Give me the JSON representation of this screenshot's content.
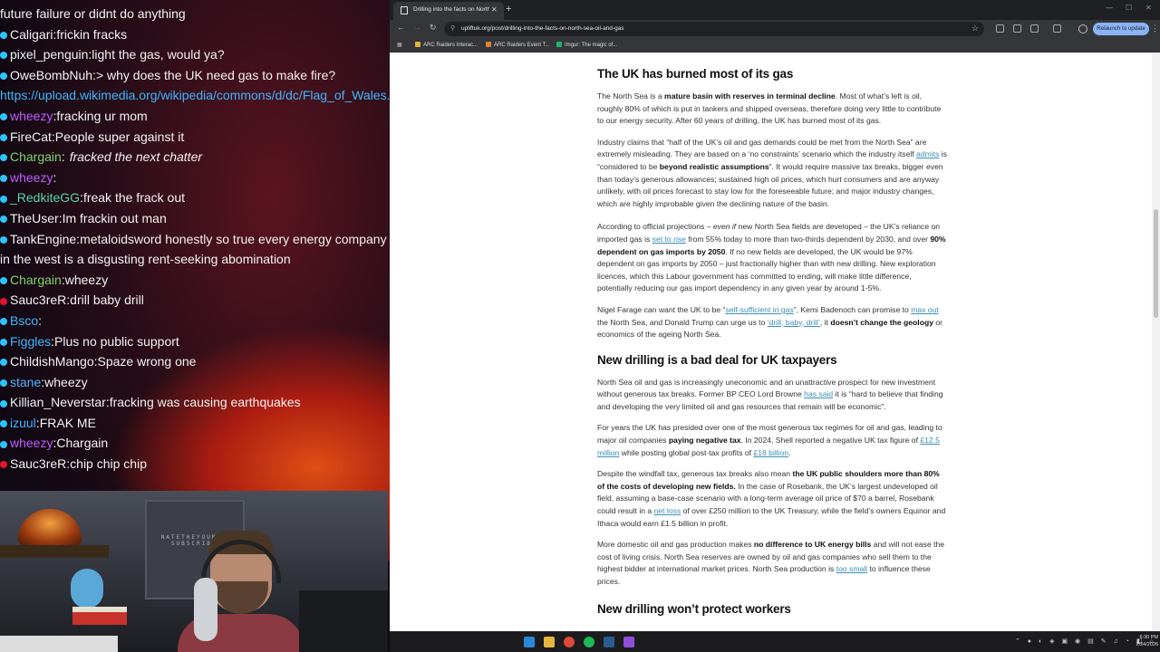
{
  "chat": {
    "messages": [
      {
        "user": "",
        "text": "future failure or didnt do anything",
        "dot": "none",
        "color": "#f2f2f2"
      },
      {
        "user": "Caligari",
        "text": "frickin fracks",
        "dot": "blue",
        "color": "#f2f2f2"
      },
      {
        "user": "pixel_penguin",
        "text": "light the gas, would ya?",
        "dot": "blue",
        "color": "#f2f2f2"
      },
      {
        "user": "OweBombNuh",
        "text": "> why does the UK need gas to make fire?",
        "dot": "blue",
        "color": "#f2f2f2"
      },
      {
        "user": "",
        "text": "https://upload.wikimedia.org/wikipedia/commons/d/dc/Flag_of_Wales.svg",
        "dot": "none",
        "color": "#3fb6ff"
      },
      {
        "user": "wheezy",
        "text": "fracking ur mom",
        "dot": "blue",
        "color": "#c05cff"
      },
      {
        "user": "FireCat",
        "text": "People super against it",
        "dot": "blue",
        "color": "#f2f2f2"
      },
      {
        "user": "Chargain",
        "text": "fracked the next chatter",
        "dot": "blue",
        "color": "#7fd36b"
      },
      {
        "user": "wheezy",
        "text": "",
        "dot": "blue",
        "color": "#c05cff"
      },
      {
        "user": "_RedkiteGG",
        "text": "freak the frack out",
        "dot": "blue",
        "color": "#5ad6a8"
      },
      {
        "user": "TheUser",
        "text": "Im frackin out man",
        "dot": "blue",
        "color": "#f2f2f2"
      },
      {
        "user": "TankEngine",
        "text": "metaloidsword honestly so true every energy company in the west is a disgusting rent-seeking abomination",
        "dot": "blue",
        "color": "#f2f2f2"
      },
      {
        "user": "Chargain",
        "text": "wheezy",
        "dot": "blue",
        "color": "#7fd36b"
      },
      {
        "user": "Sauc3reR",
        "text": "drill baby drill",
        "dot": "red",
        "color": "#f2f2f2"
      },
      {
        "user": "Bsco",
        "text": "",
        "dot": "blue",
        "color": "#3fb6ff"
      },
      {
        "user": "Figgles",
        "text": "Plus no public support",
        "dot": "blue",
        "color": "#3fb6ff"
      },
      {
        "user": "ChildishMango",
        "text": "Spaze wrong one",
        "dot": "blue",
        "color": "#f2f2f2"
      },
      {
        "user": "stane",
        "text": "wheezy",
        "dot": "blue",
        "color": "#5ab0ff"
      },
      {
        "user": "Killian_Neverstar",
        "text": "fracking was causing earthquakes",
        "dot": "blue",
        "color": "#f2f2f2"
      },
      {
        "user": "izuul",
        "text": "FRAK ME",
        "dot": "blue",
        "color": "#3fb6ff"
      },
      {
        "user": "wheezy",
        "text": "Chargain",
        "dot": "blue",
        "color": "#c05cff"
      },
      {
        "user": "Sauc3reR",
        "text": "chip chip chip",
        "dot": "red",
        "color": "#f2f2f2"
      }
    ]
  },
  "webcam": {
    "poster_text": "NATETHEYOUNGER SUBSCRIBES"
  },
  "browser": {
    "tab_title": "Drilling into the facts on North",
    "url": "upliftuk.org/post/drilling-into-the-facts-on-north-sea-oil-and-gas",
    "relaunch_label": "Relaunch to update",
    "bookmarks": [
      "ARC Raiders Interac...",
      "ARC Raiders Event T...",
      "Imgur: The magic of..."
    ]
  },
  "article": {
    "h1": "The UK has burned most of its gas",
    "p1": {
      "a": "The North Sea is a ",
      "b": "mature basin with reserves in terminal decline",
      "c": ". Most of what’s left is oil, roughly 80% of which is put in tankers and shipped overseas, therefore doing very little to contribute to our energy security. After 60 years of drilling, the UK has burned most of its gas."
    },
    "p2": {
      "a": "Industry claims that “half of the UK’s oil and gas demands could be met from the North Sea” are extremely misleading. They are based on a ‘no constraints’ scenario which the industry itself ",
      "link": "admits",
      "b": " is “considered to be ",
      "bold": "beyond realistic assumptions",
      "c": "”. It would require massive tax breaks, bigger even than today’s generous allowances; sustained high oil prices, which hurt consumers and are anyway unlikely, with oil prices forecast to stay low for the foreseeable future; and major industry changes, which are highly improbable given the declining nature of the basin."
    },
    "p3": {
      "a": "According to official projections – ",
      "em": "even if",
      "b": " new North Sea fields are developed – the UK’s reliance on imported gas is ",
      "link": "set to rise",
      "c": " from 55% today to more than two-thirds dependent by 2030, and over ",
      "bold": "90% dependent on gas imports by 2050",
      "d": ". If no new fields are developed, the UK would be 97% dependent on gas imports by 2050 – just fractionally higher than with new drilling. New exploration licences, which this Labour government has committed to ending, will make little difference, potentially reducing our gas import dependency in any given year by around 1-5%."
    },
    "p4": {
      "a": "Nigel Farage can want the UK to  be “",
      "link1": "self-sufficient in gas",
      "b": "”, Kemi Badenoch can promise to ",
      "link2": "max out",
      "c": " the North Sea, and Donald Trump can urge us to ",
      "link3": "‘drill, baby, drill’",
      "d": ", it ",
      "bold": "doesn’t change the geology",
      "e": " or economics of the ageing North Sea."
    },
    "h2": "New drilling is a bad deal for UK taxpayers",
    "p5": {
      "a": "North Sea oil and gas is increasingly uneconomic and an unattractive prospect for new investment without generous tax breaks. Former BP CEO Lord Browne ",
      "link": "has said",
      "b": " it is “hard to believe that finding and developing the very limited oil and gas resources that remain will be economic”."
    },
    "p6": {
      "a": "For years the UK has presided over one of the most generous tax regimes for oil and gas, leading to major oil companies ",
      "bold": "paying negative tax",
      "b": ".  In 2024, Shell reported a negative UK tax figure of ",
      "link1": "£12.5 million",
      "c": " while posting global post-tax profits  of ",
      "link2": "£18 billion",
      "d": "."
    },
    "p7": {
      "a": "Despite the windfall tax, generous tax breaks also mean ",
      "bold": "the UK public shoulders more than 80% of the costs of developing new fields.",
      "b": " In the case of Rosebank, the UK’s largest undeveloped oil field, assuming a base-case scenario with a long-term average oil price of $70 a barrel, Rosebank could result in a ",
      "link": "net loss",
      "c": " of over £250 million to the UK Treasury, while the field’s owners Equinor and Ithaca would earn £1.5 billion in profit."
    },
    "p8": {
      "a": "More domestic oil and gas production makes ",
      "bold": "no difference to UK energy bills",
      "b": " and will not ease the cost of living crisis. North Sea reserves are owned by oil and gas companies who sell them to the highest bidder at international market prices. North Sea production is ",
      "link": "too small",
      "c": " to influence these prices."
    },
    "h3": "New drilling won’t protect workers"
  },
  "taskbar": {
    "time": "6:30 PM",
    "date": "2/24/2026"
  }
}
